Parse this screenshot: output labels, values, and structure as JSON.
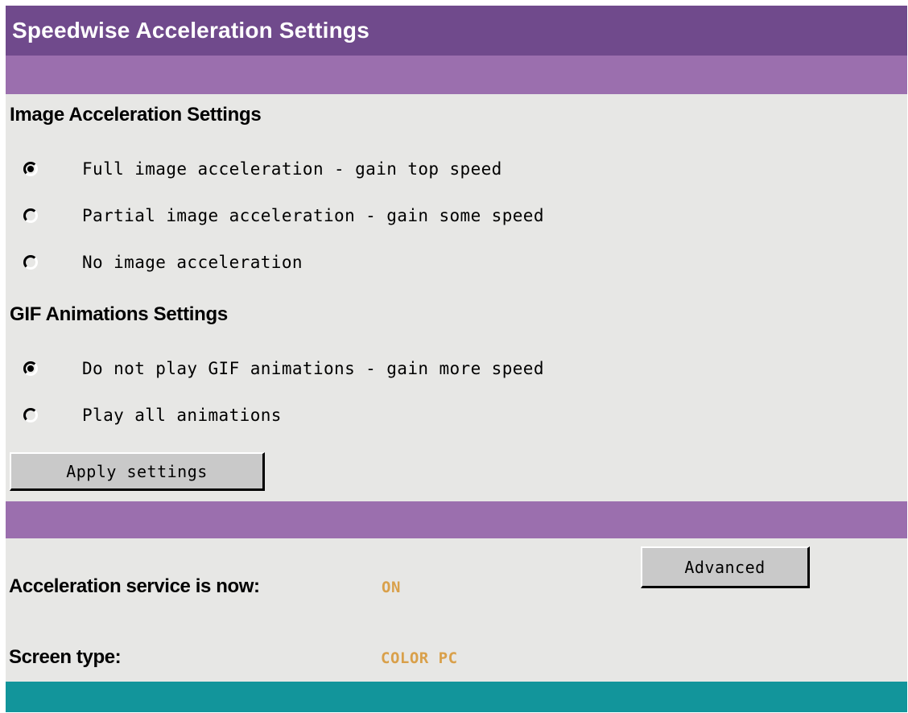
{
  "header": {
    "title": "Speedwise Acceleration Settings"
  },
  "image_settings": {
    "heading": "Image Acceleration Settings",
    "options": [
      {
        "label": "Full image acceleration - gain top speed",
        "selected": true
      },
      {
        "label": "Partial image acceleration - gain some speed",
        "selected": false
      },
      {
        "label": "No image acceleration",
        "selected": false
      }
    ]
  },
  "gif_settings": {
    "heading": "GIF Animations Settings",
    "options": [
      {
        "label": "Do not play GIF animations - gain more speed",
        "selected": true
      },
      {
        "label": "Play all animations",
        "selected": false
      }
    ]
  },
  "buttons": {
    "apply_label": "Apply settings",
    "advanced_label": "Advanced"
  },
  "status": {
    "service_label": "Acceleration service is now:",
    "service_value": "ON",
    "screen_label": "Screen type:",
    "screen_value": "COLOR PC"
  },
  "colors": {
    "title_bar": "#704a8c",
    "band": "#9b6fae",
    "footer": "#12959b",
    "status_value": "#d9a04a",
    "background": "#e7e7e5"
  }
}
